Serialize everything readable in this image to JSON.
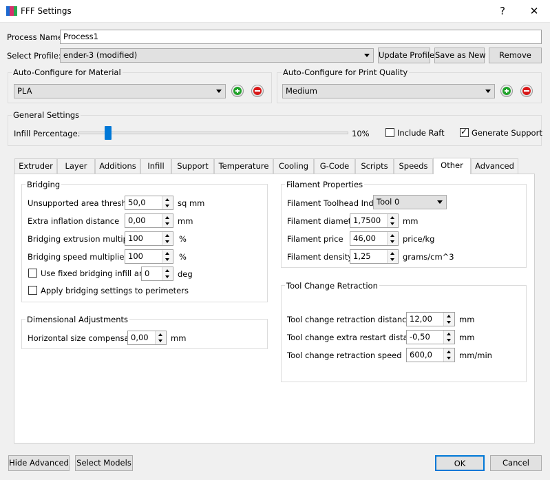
{
  "window": {
    "title": "FFF Settings",
    "help_label": "?",
    "close_label": "✕"
  },
  "process": {
    "name_label": "Process Name:",
    "name_value": "Process1"
  },
  "profile": {
    "label": "Select Profile:",
    "value": "ender-3 (modified)",
    "update_label": "Update Profile",
    "save_label": "Save as New",
    "remove_label": "Remove"
  },
  "material": {
    "title": "Auto-Configure for Material",
    "value": "PLA"
  },
  "quality": {
    "title": "Auto-Configure for Print Quality",
    "value": "Medium"
  },
  "general": {
    "title": "General Settings",
    "infill_label": "Infill Percentage:",
    "infill_value": "10%",
    "infill_fraction": 0.1,
    "raft_label": "Include Raft",
    "raft_checked": false,
    "support_label": "Generate Support",
    "support_checked": true
  },
  "tabs": [
    "Extruder",
    "Layer",
    "Additions",
    "Infill",
    "Support",
    "Temperature",
    "Cooling",
    "G-Code",
    "Scripts",
    "Speeds",
    "Other",
    "Advanced"
  ],
  "active_tab": "Other",
  "bridging": {
    "title": "Bridging",
    "rows": [
      {
        "label": "Unsupported area threshold",
        "value": "50,0",
        "unit": "sq mm"
      },
      {
        "label": "Extra inflation distance",
        "value": "0,00",
        "unit": "mm"
      },
      {
        "label": "Bridging extrusion multiplier",
        "value": "100",
        "unit": "%"
      },
      {
        "label": "Bridging speed multiplier",
        "value": "100",
        "unit": "%"
      }
    ],
    "fixed_angle_label": "Use fixed bridging infill angle",
    "fixed_angle_value": "0",
    "fixed_angle_unit": "deg",
    "perimeters_label": "Apply bridging settings to perimeters"
  },
  "dimensional": {
    "title": "Dimensional Adjustments",
    "label": "Horizontal size compensation",
    "value": "0,00",
    "unit": "mm"
  },
  "filament": {
    "title": "Filament Properties",
    "toolhead_label": "Filament Toolhead Index",
    "toolhead_value": "Tool 0",
    "rows": [
      {
        "label": "Filament diameter",
        "value": "1,7500",
        "unit": "mm"
      },
      {
        "label": "Filament price",
        "value": "46,00",
        "unit": "price/kg"
      },
      {
        "label": "Filament density",
        "value": "1,25",
        "unit": "grams/cm^3"
      }
    ]
  },
  "toolchange": {
    "title": "Tool Change Retraction",
    "rows": [
      {
        "label": "Tool change retraction distance",
        "value": "12,00",
        "unit": "mm"
      },
      {
        "label": "Tool change extra restart distance",
        "value": "-0,50",
        "unit": "mm"
      },
      {
        "label": "Tool change retraction speed",
        "value": "600,0",
        "unit": "mm/min"
      }
    ]
  },
  "footer": {
    "hide_advanced_label": "Hide Advanced",
    "select_models_label": "Select Models",
    "ok_label": "OK",
    "cancel_label": "Cancel"
  },
  "colors": {
    "add": "#22a32b",
    "remove": "#d81818",
    "accent": "#0078d7",
    "slider_track": "#c6c6c6"
  }
}
